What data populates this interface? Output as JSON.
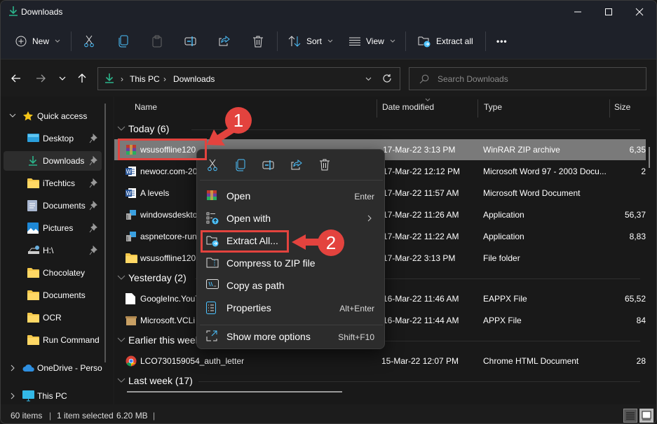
{
  "window": {
    "title": "Downloads"
  },
  "window_controls": {
    "minimize": "minimize-icon",
    "maximize": "maximize-icon",
    "close": "close-icon"
  },
  "command_bar": {
    "new_label": "New",
    "sort_label": "Sort",
    "view_label": "View",
    "extract_all_label": "Extract all",
    "more_label": "•••",
    "icons": [
      "cut-icon",
      "copy-icon",
      "paste-icon",
      "rename-icon",
      "share-icon",
      "delete-icon"
    ]
  },
  "nav": {
    "breadcrumb": [
      "This PC",
      "Downloads"
    ],
    "search_placeholder": "Search Downloads"
  },
  "sidebar": {
    "quick_access": "Quick access",
    "items": [
      {
        "label": "Desktop",
        "icon": "desktop-icon",
        "pinned": true
      },
      {
        "label": "Downloads",
        "icon": "downloads-icon",
        "pinned": true,
        "active": true
      },
      {
        "label": "iTechtics",
        "icon": "folder-icon",
        "pinned": true
      },
      {
        "label": "Documents",
        "icon": "documents-icon",
        "pinned": true
      },
      {
        "label": "Pictures",
        "icon": "pictures-icon",
        "pinned": true
      },
      {
        "label": "H:\\",
        "icon": "network-drive-icon",
        "pinned": true
      },
      {
        "label": "Chocolatey",
        "icon": "folder-icon"
      },
      {
        "label": "Documents",
        "icon": "folder-icon"
      },
      {
        "label": "OCR",
        "icon": "folder-icon"
      },
      {
        "label": "Run Command",
        "icon": "folder-icon"
      }
    ],
    "onedrive": "OneDrive - Perso",
    "this_pc": "This PC"
  },
  "columns": {
    "name": "Name",
    "date": "Date modified",
    "type": "Type",
    "size": "Size"
  },
  "groups": [
    {
      "label": "Today (6)",
      "files": [
        {
          "name": "wsusoffline120",
          "date": "17-Mar-22 3:13 PM",
          "type": "WinRAR ZIP archive",
          "size": "6,35",
          "icon": "winrar-icon",
          "selected": true
        },
        {
          "name": "newocr.com-20",
          "date": "17-Mar-22 12:12 PM",
          "type": "Microsoft Word 97 - 2003 Docu...",
          "size": "2",
          "icon": "word-icon"
        },
        {
          "name": "A levels",
          "date": "17-Mar-22 11:57 AM",
          "type": "Microsoft Word Document",
          "size": "",
          "icon": "word-icon"
        },
        {
          "name": "windowsdesktop",
          "date": "17-Mar-22 11:26 AM",
          "type": "Application",
          "size": "56,37",
          "icon": "installer-icon"
        },
        {
          "name": "aspnetcore-run",
          "date": "17-Mar-22 11:22 AM",
          "type": "Application",
          "size": "8,83",
          "icon": "installer-icon"
        },
        {
          "name": "wsusoffline120",
          "date": "17-Mar-22 3:13 PM",
          "type": "File folder",
          "size": "",
          "icon": "folder-icon"
        }
      ]
    },
    {
      "label": "Yesterday (2)",
      "files": [
        {
          "name": "GoogleInc.YouT",
          "date": "16-Mar-22 11:46 AM",
          "type": "EAPPX File",
          "size": "65,52",
          "icon": "file-icon"
        },
        {
          "name": "Microsoft.VCLi",
          "date": "16-Mar-22 11:44 AM",
          "type": "APPX File",
          "size": "84",
          "icon": "package-icon"
        }
      ]
    },
    {
      "label": "Earlier this week",
      "files": [
        {
          "name": "LCO730159054_auth_letter",
          "date": "15-Mar-22 12:07 PM",
          "type": "Chrome HTML Document",
          "size": "28",
          "icon": "chrome-icon"
        }
      ]
    },
    {
      "label": "Last week (17)",
      "files": []
    }
  ],
  "context_menu": {
    "quick_actions": [
      "cut-icon",
      "copy-icon",
      "rename-icon",
      "share-icon",
      "delete-icon"
    ],
    "items": [
      {
        "label": "Open",
        "shortcut": "Enter",
        "icon": "winrar-icon"
      },
      {
        "label": "Open with",
        "shortcut": "",
        "icon": "open-with-icon",
        "submenu": true
      },
      {
        "label": "Extract All...",
        "shortcut": "",
        "icon": "extract-icon"
      },
      {
        "label": "Compress to ZIP file",
        "shortcut": "",
        "icon": "zip-icon"
      },
      {
        "label": "Copy as path",
        "shortcut": "",
        "icon": "copy-path-icon"
      },
      {
        "label": "Properties",
        "shortcut": "Alt+Enter",
        "icon": "properties-icon"
      },
      {
        "label": "Show more options",
        "shortcut": "Shift+F10",
        "icon": "more-options-icon"
      }
    ]
  },
  "callouts": {
    "step1": "1",
    "step2": "2",
    "color": "#e3433e"
  },
  "status": {
    "items": "60 items",
    "selected": "1 item selected",
    "size": "6.20 MB"
  },
  "colors": {
    "accent": "#4cc2ff",
    "folder": "#f3c74a",
    "download_green": "#2bb48b",
    "selection": "#7a7a7a"
  }
}
